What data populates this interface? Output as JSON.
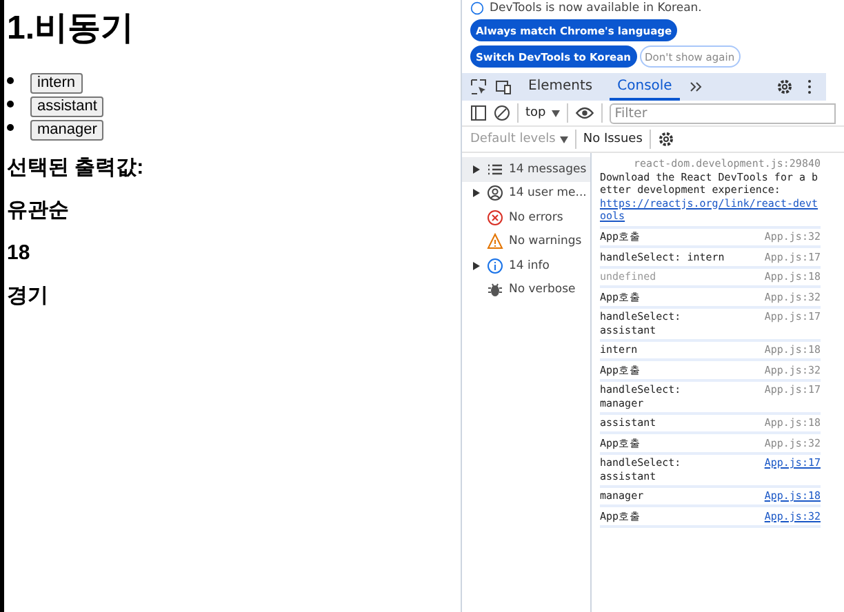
{
  "page": {
    "title": "1.비동기",
    "buttons": [
      "intern",
      "assistant",
      "manager"
    ],
    "output_label": "선택된 출력값:",
    "values": [
      "유관순",
      "18",
      "경기"
    ]
  },
  "devtools": {
    "notice": "DevTools is now available in Korean.",
    "notice_buttons": [
      {
        "label": "Always match Chrome's language",
        "kind": "primary"
      },
      {
        "label": "Switch DevTools to Korean",
        "kind": "primary"
      },
      {
        "label": "Don't show again",
        "kind": "outline"
      }
    ],
    "tabs": [
      {
        "label": "Elements",
        "selected": false
      },
      {
        "label": "Console",
        "selected": true
      }
    ],
    "context": "top",
    "filter": {
      "placeholder": "Filter"
    },
    "levels": "Default levels",
    "issues": "No Issues",
    "sidebar": [
      {
        "label": "14 messages",
        "kind": "list",
        "expandable": true,
        "selected": true
      },
      {
        "label": "14 user me...",
        "kind": "user",
        "expandable": true,
        "selected": false
      },
      {
        "label": "No errors",
        "kind": "error",
        "expandable": false,
        "selected": false
      },
      {
        "label": "No warnings",
        "kind": "warning",
        "expandable": false,
        "selected": false
      },
      {
        "label": "14 info",
        "kind": "info",
        "expandable": true,
        "selected": false
      },
      {
        "label": "No verbose",
        "kind": "verbose",
        "expandable": false,
        "selected": false
      }
    ],
    "messages": [
      {
        "kind": "notice",
        "source": "react-dom.development.js:29840",
        "text": "Download the React DevTools for a better development experience: ",
        "link": "https://reactjs.org/link/react-devtools"
      },
      {
        "kind": "log",
        "text": "App호출",
        "source": "App.js:32",
        "source_link": false
      },
      {
        "kind": "log",
        "text": "handleSelect: intern",
        "source": "App.js:17",
        "source_link": false
      },
      {
        "kind": "muted",
        "text": "undefined",
        "source": "App.js:18",
        "source_link": false
      },
      {
        "kind": "log",
        "text": "App호출",
        "source": "App.js:32",
        "source_link": false
      },
      {
        "kind": "log",
        "text": "handleSelect: assistant",
        "source": "App.js:17",
        "source_link": false
      },
      {
        "kind": "log",
        "text": "intern",
        "source": "App.js:18",
        "source_link": false
      },
      {
        "kind": "log",
        "text": "App호출",
        "source": "App.js:32",
        "source_link": false
      },
      {
        "kind": "log",
        "text": "handleSelect: manager",
        "source": "App.js:17",
        "source_link": false
      },
      {
        "kind": "log",
        "text": "assistant",
        "source": "App.js:18",
        "source_link": false
      },
      {
        "kind": "log",
        "text": "App호출",
        "source": "App.js:32",
        "source_link": false
      },
      {
        "kind": "log",
        "text": "handleSelect: assistant",
        "source": "App.js:17",
        "source_link": true
      },
      {
        "kind": "log",
        "text": "manager",
        "source": "App.js:18",
        "source_link": true
      },
      {
        "kind": "log",
        "text": "App호출",
        "source": "App.js:32",
        "source_link": true
      }
    ]
  }
}
